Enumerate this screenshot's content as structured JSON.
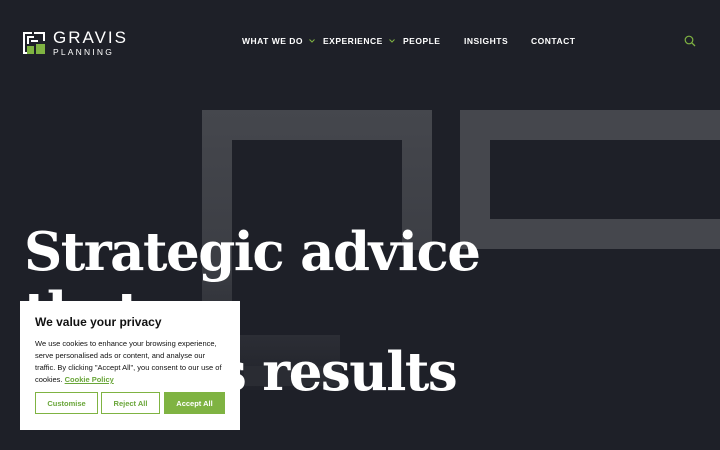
{
  "brand": {
    "name": "GRAVIS",
    "sub": "PLANNING",
    "accent": "#7fb342",
    "logo_icon": "gravis-logo-mark"
  },
  "nav": {
    "items": [
      {
        "label": "WHAT WE DO",
        "has_dropdown": true
      },
      {
        "label": "EXPERIENCE",
        "has_dropdown": true
      },
      {
        "label": "PEOPLE",
        "has_dropdown": false
      },
      {
        "label": "INSIGHTS",
        "has_dropdown": false
      },
      {
        "label": "CONTACT",
        "has_dropdown": false
      }
    ],
    "search_icon": "search-icon"
  },
  "hero": {
    "line1": "Strategic advice that",
    "line2": "delivers results"
  },
  "cookie": {
    "title": "We value your privacy",
    "body": "We use cookies to enhance your browsing experience, serve personalised ads or content, and analyse our traffic. By clicking \"Accept All\", you consent to our use of cookies.",
    "link": "Cookie Policy",
    "customise": "Customise",
    "reject": "Reject All",
    "accept": "Accept All"
  },
  "colors": {
    "background": "#1e2028",
    "shape": "#44464c",
    "white": "#ffffff"
  }
}
